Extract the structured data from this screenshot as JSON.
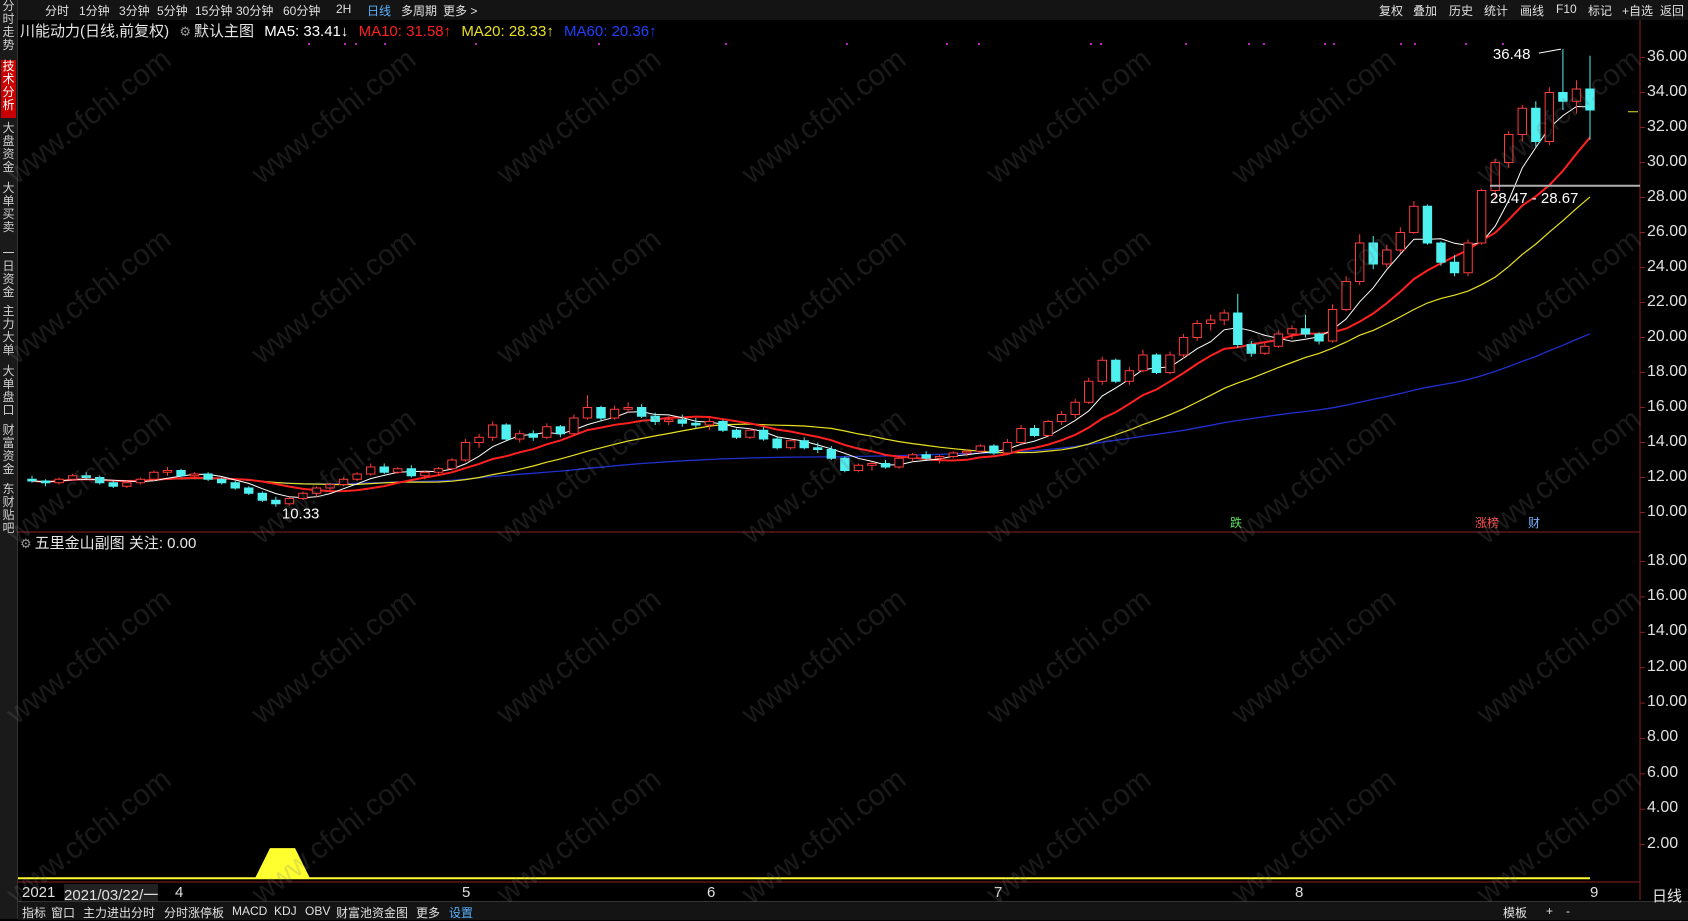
{
  "left_tabs": [
    "分时走势",
    "技术分析",
    "大盘资金",
    "大单买卖",
    "一日资金",
    "主力大单",
    "大单盘口",
    "财富资金",
    "东财贴吧"
  ],
  "periods": [
    "分时",
    "1分钟",
    "3分钟",
    "5分钟",
    "15分钟",
    "30分钟",
    "60分钟",
    "2H",
    "日线",
    "多周期",
    "更多 >"
  ],
  "active_period": "日线",
  "tools": [
    "复权",
    "叠加",
    "历史",
    "统计",
    "画线",
    "F10",
    "标记",
    "+自选",
    "返回"
  ],
  "info": {
    "stock": "川能动力(日线,前复权)",
    "main_chart": "默认主图",
    "ma5": "MA5: 33.41↓",
    "ma10": "MA10: 31.58↑",
    "ma20": "MA20: 28.33↑",
    "ma60": "MA60: 20.36↑"
  },
  "colors": {
    "up": "#ff3a3a",
    "down": "#4ff0f0",
    "ma5": "#ffffff",
    "ma10": "#ff2020",
    "ma20": "#e8e020",
    "ma60": "#2030d0",
    "accent": "#5ab0ff"
  },
  "subchart": {
    "title": "五里金山副图 关注: 0.00"
  },
  "bottom_tabs": [
    "指标",
    "窗口",
    "主力进出分时",
    "分时涨停板",
    "MACD",
    "KDJ",
    "OBV",
    "财富池资金图",
    "更多",
    "设置"
  ],
  "active_bottom_tab": "设置",
  "right_bottom": {
    "period": "日线",
    "template": "模板",
    "plus": "+",
    "minus": "-"
  },
  "date_labels": [
    "2021",
    "2021/03/22/一",
    "4",
    "5",
    "6",
    "7",
    "8",
    "9"
  ],
  "annotations": {
    "high": "36.48",
    "low": "10.33",
    "range": "28.47 - 28.67",
    "markers": [
      "跌",
      "涨榜",
      "财"
    ]
  },
  "watermark": "www.cfchi.com",
  "chart_data": {
    "type": "candlestick",
    "y_ticks": [
      "36.00",
      "34.00",
      "32.00",
      "30.00",
      "28.00",
      "26.00",
      "24.00",
      "22.00",
      "20.00",
      "18.00",
      "16.00",
      "14.00",
      "12.00",
      "10.00"
    ],
    "ylim": [
      9.0,
      37.0
    ],
    "sub_y_ticks": [
      "18.00",
      "16.00",
      "14.00",
      "12.00",
      "10.00",
      "8.00",
      "6.00",
      "4.00",
      "2.00"
    ],
    "sub_ylim": [
      0,
      19.5
    ],
    "months": [
      "4",
      "5",
      "6",
      "7",
      "8",
      "9"
    ],
    "candles": [
      [
        11.9,
        12.1,
        11.7,
        11.8
      ],
      [
        11.8,
        11.9,
        11.5,
        11.7
      ],
      [
        11.7,
        12.0,
        11.6,
        11.9
      ],
      [
        11.9,
        12.2,
        11.8,
        12.1
      ],
      [
        12.1,
        12.3,
        11.9,
        12.0
      ],
      [
        12.0,
        12.1,
        11.6,
        11.7
      ],
      [
        11.7,
        11.8,
        11.4,
        11.5
      ],
      [
        11.5,
        11.8,
        11.4,
        11.7
      ],
      [
        11.7,
        12.0,
        11.6,
        11.9
      ],
      [
        11.9,
        12.4,
        11.8,
        12.3
      ],
      [
        12.3,
        12.6,
        12.1,
        12.4
      ],
      [
        12.4,
        12.5,
        12.0,
        12.1
      ],
      [
        12.1,
        12.3,
        11.9,
        12.2
      ],
      [
        12.2,
        12.3,
        11.8,
        11.9
      ],
      [
        11.9,
        12.0,
        11.6,
        11.7
      ],
      [
        11.7,
        11.8,
        11.3,
        11.4
      ],
      [
        11.4,
        11.5,
        11.0,
        11.1
      ],
      [
        11.1,
        11.2,
        10.6,
        10.7
      ],
      [
        10.7,
        10.9,
        10.33,
        10.5
      ],
      [
        10.5,
        10.9,
        10.4,
        10.8
      ],
      [
        10.8,
        11.2,
        10.7,
        11.1
      ],
      [
        11.1,
        11.5,
        10.9,
        11.4
      ],
      [
        11.4,
        11.7,
        11.2,
        11.6
      ],
      [
        11.6,
        12.0,
        11.5,
        11.9
      ],
      [
        11.9,
        12.3,
        11.8,
        12.2
      ],
      [
        12.2,
        12.8,
        12.1,
        12.6
      ],
      [
        12.6,
        12.8,
        12.2,
        12.3
      ],
      [
        12.3,
        12.6,
        12.2,
        12.5
      ],
      [
        12.5,
        12.7,
        12.0,
        12.1
      ],
      [
        12.1,
        12.4,
        11.9,
        12.3
      ],
      [
        12.3,
        12.6,
        12.1,
        12.5
      ],
      [
        12.5,
        13.1,
        12.4,
        13.0
      ],
      [
        13.0,
        14.2,
        12.9,
        14.0
      ],
      [
        14.0,
        14.5,
        13.7,
        14.3
      ],
      [
        14.3,
        15.2,
        14.1,
        15.0
      ],
      [
        15.0,
        15.1,
        14.1,
        14.2
      ],
      [
        14.2,
        14.7,
        14.0,
        14.5
      ],
      [
        14.5,
        14.7,
        14.1,
        14.3
      ],
      [
        14.3,
        15.1,
        14.2,
        14.9
      ],
      [
        14.9,
        15.0,
        14.3,
        14.5
      ],
      [
        14.5,
        15.6,
        14.4,
        15.4
      ],
      [
        15.4,
        16.7,
        15.3,
        16.0
      ],
      [
        16.0,
        16.1,
        15.2,
        15.4
      ],
      [
        15.4,
        16.1,
        15.3,
        15.9
      ],
      [
        15.9,
        16.3,
        15.7,
        16.0
      ],
      [
        16.0,
        16.2,
        15.4,
        15.5
      ],
      [
        15.5,
        15.7,
        15.0,
        15.2
      ],
      [
        15.2,
        15.5,
        15.0,
        15.3
      ],
      [
        15.3,
        15.6,
        14.9,
        15.1
      ],
      [
        15.1,
        15.4,
        14.8,
        15.0
      ],
      [
        15.0,
        15.4,
        14.7,
        15.2
      ],
      [
        15.2,
        15.3,
        14.6,
        14.7
      ],
      [
        14.7,
        14.8,
        14.2,
        14.3
      ],
      [
        14.3,
        14.8,
        14.2,
        14.7
      ],
      [
        14.7,
        14.9,
        14.1,
        14.2
      ],
      [
        14.2,
        14.3,
        13.6,
        13.7
      ],
      [
        13.7,
        14.2,
        13.6,
        14.1
      ],
      [
        14.1,
        14.3,
        13.6,
        13.7
      ],
      [
        13.7,
        14.0,
        13.4,
        13.6
      ],
      [
        13.6,
        13.8,
        13.0,
        13.1
      ],
      [
        13.1,
        13.2,
        12.3,
        12.4
      ],
      [
        12.4,
        12.8,
        12.3,
        12.7
      ],
      [
        12.7,
        12.9,
        12.4,
        12.8
      ],
      [
        12.8,
        13.0,
        12.5,
        12.6
      ],
      [
        12.6,
        13.2,
        12.5,
        13.1
      ],
      [
        13.1,
        13.4,
        12.9,
        13.3
      ],
      [
        13.3,
        13.5,
        13.0,
        13.1
      ],
      [
        13.1,
        13.3,
        12.8,
        13.2
      ],
      [
        13.2,
        13.5,
        13.1,
        13.4
      ],
      [
        13.4,
        13.6,
        13.2,
        13.5
      ],
      [
        13.5,
        13.9,
        13.4,
        13.8
      ],
      [
        13.8,
        13.9,
        13.3,
        13.4
      ],
      [
        13.4,
        14.2,
        13.3,
        14.0
      ],
      [
        14.0,
        15.0,
        13.9,
        14.8
      ],
      [
        14.8,
        15.0,
        14.3,
        14.4
      ],
      [
        14.4,
        15.3,
        14.3,
        15.2
      ],
      [
        15.2,
        15.8,
        15.0,
        15.6
      ],
      [
        15.6,
        16.5,
        15.4,
        16.3
      ],
      [
        16.3,
        17.7,
        16.2,
        17.5
      ],
      [
        17.5,
        18.9,
        17.3,
        18.7
      ],
      [
        18.7,
        18.8,
        17.4,
        17.5
      ],
      [
        17.5,
        18.3,
        17.3,
        18.1
      ],
      [
        18.1,
        19.3,
        18.0,
        19.0
      ],
      [
        19.0,
        19.1,
        17.9,
        18.0
      ],
      [
        18.0,
        19.2,
        17.9,
        19.0
      ],
      [
        19.0,
        20.2,
        18.8,
        20.0
      ],
      [
        20.0,
        21.0,
        19.8,
        20.8
      ],
      [
        20.8,
        21.3,
        20.4,
        21.0
      ],
      [
        21.0,
        21.6,
        20.7,
        21.4
      ],
      [
        21.4,
        22.5,
        19.4,
        19.6
      ],
      [
        19.6,
        19.8,
        18.9,
        19.1
      ],
      [
        19.1,
        19.7,
        19.0,
        19.5
      ],
      [
        19.5,
        20.4,
        19.4,
        20.2
      ],
      [
        20.2,
        20.7,
        19.9,
        20.5
      ],
      [
        20.5,
        21.3,
        20.0,
        20.2
      ],
      [
        20.2,
        20.3,
        19.6,
        19.8
      ],
      [
        19.8,
        21.9,
        19.7,
        21.6
      ],
      [
        21.6,
        23.5,
        21.5,
        23.2
      ],
      [
        23.2,
        25.9,
        23.0,
        25.4
      ],
      [
        25.4,
        25.8,
        23.9,
        24.2
      ],
      [
        24.2,
        25.3,
        24.0,
        25.0
      ],
      [
        25.0,
        26.3,
        24.8,
        26.0
      ],
      [
        26.0,
        27.8,
        25.9,
        27.5
      ],
      [
        27.5,
        27.6,
        25.3,
        25.4
      ],
      [
        25.4,
        25.5,
        24.1,
        24.3
      ],
      [
        24.3,
        24.7,
        23.5,
        23.7
      ],
      [
        23.7,
        25.6,
        23.5,
        25.4
      ],
      [
        25.4,
        28.5,
        25.3,
        28.4
      ],
      [
        28.4,
        30.2,
        27.9,
        30.0
      ],
      [
        30.0,
        31.8,
        29.7,
        31.6
      ],
      [
        31.6,
        33.3,
        31.2,
        33.1
      ],
      [
        33.1,
        33.5,
        30.9,
        31.2
      ],
      [
        31.2,
        34.3,
        31.0,
        34.0
      ],
      [
        34.0,
        36.48,
        33.0,
        33.5
      ],
      [
        33.5,
        34.7,
        32.8,
        34.2
      ],
      [
        34.2,
        36.1,
        31.3,
        33.0
      ]
    ]
  }
}
